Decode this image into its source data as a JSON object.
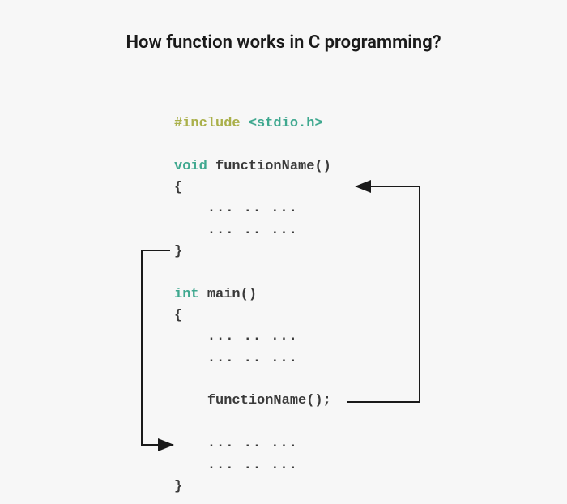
{
  "title": "How function works in C programming?",
  "code": {
    "include_kw": "#include ",
    "include_header": "<stdio.h>",
    "void_kw": "void ",
    "fn_name": "functionName",
    "parens": "()",
    "open_brace": "{",
    "close_brace": "}",
    "dots_line": "... .. ...",
    "int_kw": "int ",
    "main_name": "main",
    "fn_call": "functionName();"
  }
}
